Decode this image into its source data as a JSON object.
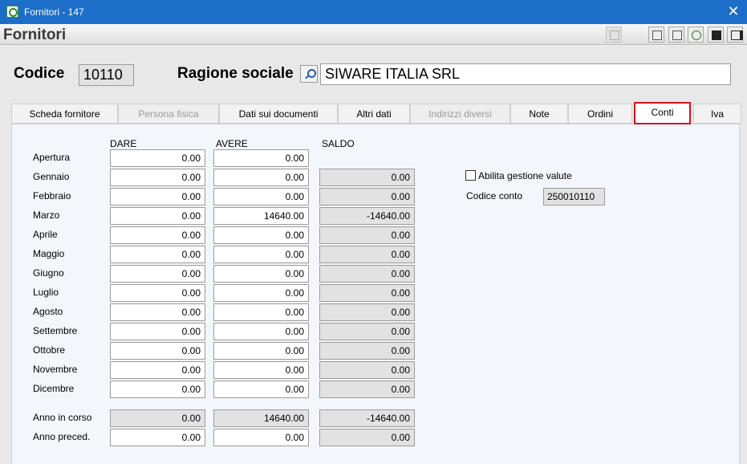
{
  "window": {
    "title": "Fornitori - 147",
    "close_glyph": "✕"
  },
  "header": {
    "form_title": "Fornitori"
  },
  "form": {
    "codice_label": "Codice",
    "codice_value": "10110",
    "ragione_label": "Ragione sociale",
    "ragione_value": "SIWARE ITALIA SRL"
  },
  "tabs": [
    {
      "label": "Scheda fornitore",
      "state": "normal"
    },
    {
      "label": "Persona fisica",
      "state": "disabled"
    },
    {
      "label": "Dati sui documenti",
      "state": "normal"
    },
    {
      "label": "Altri dati",
      "state": "normal"
    },
    {
      "label": "Indirizzi diversi",
      "state": "disabled"
    },
    {
      "label": "Note",
      "state": "normal"
    },
    {
      "label": "Ordini",
      "state": "normal"
    },
    {
      "label": "Conti",
      "state": "active"
    },
    {
      "label": "Iva",
      "state": "normal"
    }
  ],
  "conti": {
    "headers": {
      "dare": "DARE",
      "avere": "AVERE",
      "saldo": "SALDO"
    },
    "rows": [
      {
        "label": "Apertura",
        "dare": "0.00",
        "avere": "0.00",
        "saldo": null
      },
      {
        "label": "Gennaio",
        "dare": "0.00",
        "avere": "0.00",
        "saldo": "0.00"
      },
      {
        "label": "Febbraio",
        "dare": "0.00",
        "avere": "0.00",
        "saldo": "0.00"
      },
      {
        "label": "Marzo",
        "dare": "0.00",
        "avere": "14640.00",
        "saldo": "-14640.00"
      },
      {
        "label": "Aprile",
        "dare": "0.00",
        "avere": "0.00",
        "saldo": "0.00"
      },
      {
        "label": "Maggio",
        "dare": "0.00",
        "avere": "0.00",
        "saldo": "0.00"
      },
      {
        "label": "Giugno",
        "dare": "0.00",
        "avere": "0.00",
        "saldo": "0.00"
      },
      {
        "label": "Luglio",
        "dare": "0.00",
        "avere": "0.00",
        "saldo": "0.00"
      },
      {
        "label": "Agosto",
        "dare": "0.00",
        "avere": "0.00",
        "saldo": "0.00"
      },
      {
        "label": "Settembre",
        "dare": "0.00",
        "avere": "0.00",
        "saldo": "0.00"
      },
      {
        "label": "Ottobre",
        "dare": "0.00",
        "avere": "0.00",
        "saldo": "0.00"
      },
      {
        "label": "Novembre",
        "dare": "0.00",
        "avere": "0.00",
        "saldo": "0.00"
      },
      {
        "label": "Dicembre",
        "dare": "0.00",
        "avere": "0.00",
        "saldo": "0.00"
      }
    ],
    "anno_in_corso": {
      "label": "Anno in corso",
      "dare": "0.00",
      "avere": "14640.00",
      "saldo": "-14640.00"
    },
    "anno_preced": {
      "label": "Anno preced.",
      "dare": "0.00",
      "avere": "0.00",
      "saldo": "0.00"
    },
    "abilita_valute_label": "Abilita gestione valute",
    "abilita_valute_checked": false,
    "codice_conto_label": "Codice conto",
    "codice_conto_value": "250010110"
  },
  "colors": {
    "titlebar": "#1c6ec8",
    "active_tab_border": "#d0141e"
  },
  "toolbar_icons": [
    "print-preview-icon",
    "calculator-icon",
    "edit-icon",
    "recycle-icon",
    "save-icon",
    "exit-icon"
  ]
}
